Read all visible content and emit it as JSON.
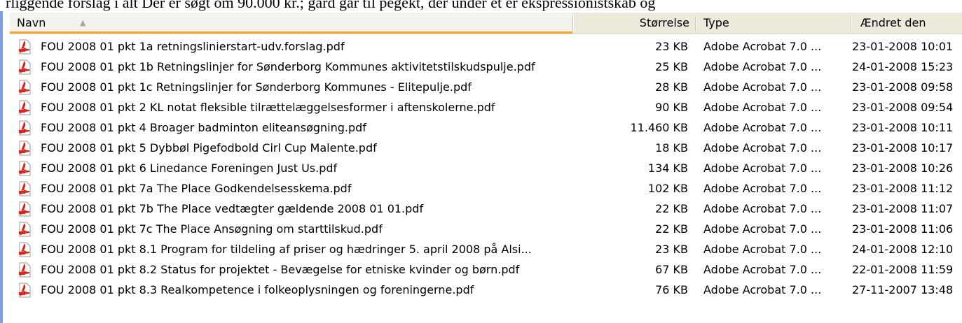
{
  "top_text": "rliggende forslag i alt Der er søgt om 90.000 kr.; gård går til pegekt, der under et er ekspressionistskab og",
  "columns": {
    "name": "Navn",
    "size": "Størrelse",
    "type": "Type",
    "modified": "Ændret den"
  },
  "sort": {
    "column": "name",
    "direction": "ascending"
  },
  "colors": {
    "accent_underline": "#f7a535",
    "pdf_icon": "#d8261e",
    "left_bar": "#7b9fe0"
  },
  "file_icon": "pdf-file-icon",
  "files": [
    {
      "name": "FOU 2008 01 pkt 1a retningslinierstart-udv.forslag.pdf",
      "size": "23 KB",
      "type": "Adobe Acrobat 7.0 ...",
      "modified": "23-01-2008 10:01"
    },
    {
      "name": "FOU 2008 01 pkt 1b Retningslinjer for Sønderborg Kommunes aktivitetstilskudspulje.pdf",
      "size": "25 KB",
      "type": "Adobe Acrobat 7.0 ...",
      "modified": "24-01-2008 15:23"
    },
    {
      "name": "FOU 2008 01 pkt 1c Retningslinjer for Sønderborg Kommunes - Elitepulje.pdf",
      "size": "28 KB",
      "type": "Adobe Acrobat 7.0 ...",
      "modified": "23-01-2008 09:58"
    },
    {
      "name": "FOU 2008 01 pkt 2 KL notat fleksible tilrættelæggelsesformer i aftenskolerne.pdf",
      "size": "90 KB",
      "type": "Adobe Acrobat 7.0 ...",
      "modified": "23-01-2008 09:54"
    },
    {
      "name": "FOU 2008 01 pkt 4 Broager badminton eliteansøgning.pdf",
      "size": "11.460 KB",
      "type": "Adobe Acrobat 7.0 ...",
      "modified": "23-01-2008 10:11"
    },
    {
      "name": "FOU 2008 01 pkt 5 Dybbøl Pigefodbold Cirl Cup Malente.pdf",
      "size": "18 KB",
      "type": "Adobe Acrobat 7.0 ...",
      "modified": "23-01-2008 10:17"
    },
    {
      "name": "FOU 2008 01 pkt 6 Linedance Foreningen Just Us.pdf",
      "size": "134 KB",
      "type": "Adobe Acrobat 7.0 ...",
      "modified": "23-01-2008 10:26"
    },
    {
      "name": "FOU 2008 01 pkt 7a The Place Godkendelsesskema.pdf",
      "size": "102 KB",
      "type": "Adobe Acrobat 7.0 ...",
      "modified": "23-01-2008 11:12"
    },
    {
      "name": "FOU 2008 01 pkt 7b The Place vedtægter gældende 2008 01 01.pdf",
      "size": "22 KB",
      "type": "Adobe Acrobat 7.0 ...",
      "modified": "23-01-2008 11:07"
    },
    {
      "name": "FOU 2008 01 pkt 7c The Place  Ansøgning om starttilskud.pdf",
      "size": "22 KB",
      "type": "Adobe Acrobat 7.0 ...",
      "modified": "23-01-2008 11:06"
    },
    {
      "name": "FOU 2008 01 pkt 8.1 Program for tildeling af priser og hædringer 5. april 2008 på Alsi...",
      "size": "23 KB",
      "type": "Adobe Acrobat 7.0 ...",
      "modified": "24-01-2008 12:10"
    },
    {
      "name": "FOU 2008 01 pkt 8.2 Status for projektet - Bevægelse for etniske kvinder og børn.pdf",
      "size": "67 KB",
      "type": "Adobe Acrobat 7.0 ...",
      "modified": "22-01-2008 11:59"
    },
    {
      "name": "FOU 2008 01 pkt 8.3 Realkompetence i folkeoplysningen og foreningerne.pdf",
      "size": "76 KB",
      "type": "Adobe Acrobat 7.0 ...",
      "modified": "27-11-2007 13:48"
    }
  ]
}
